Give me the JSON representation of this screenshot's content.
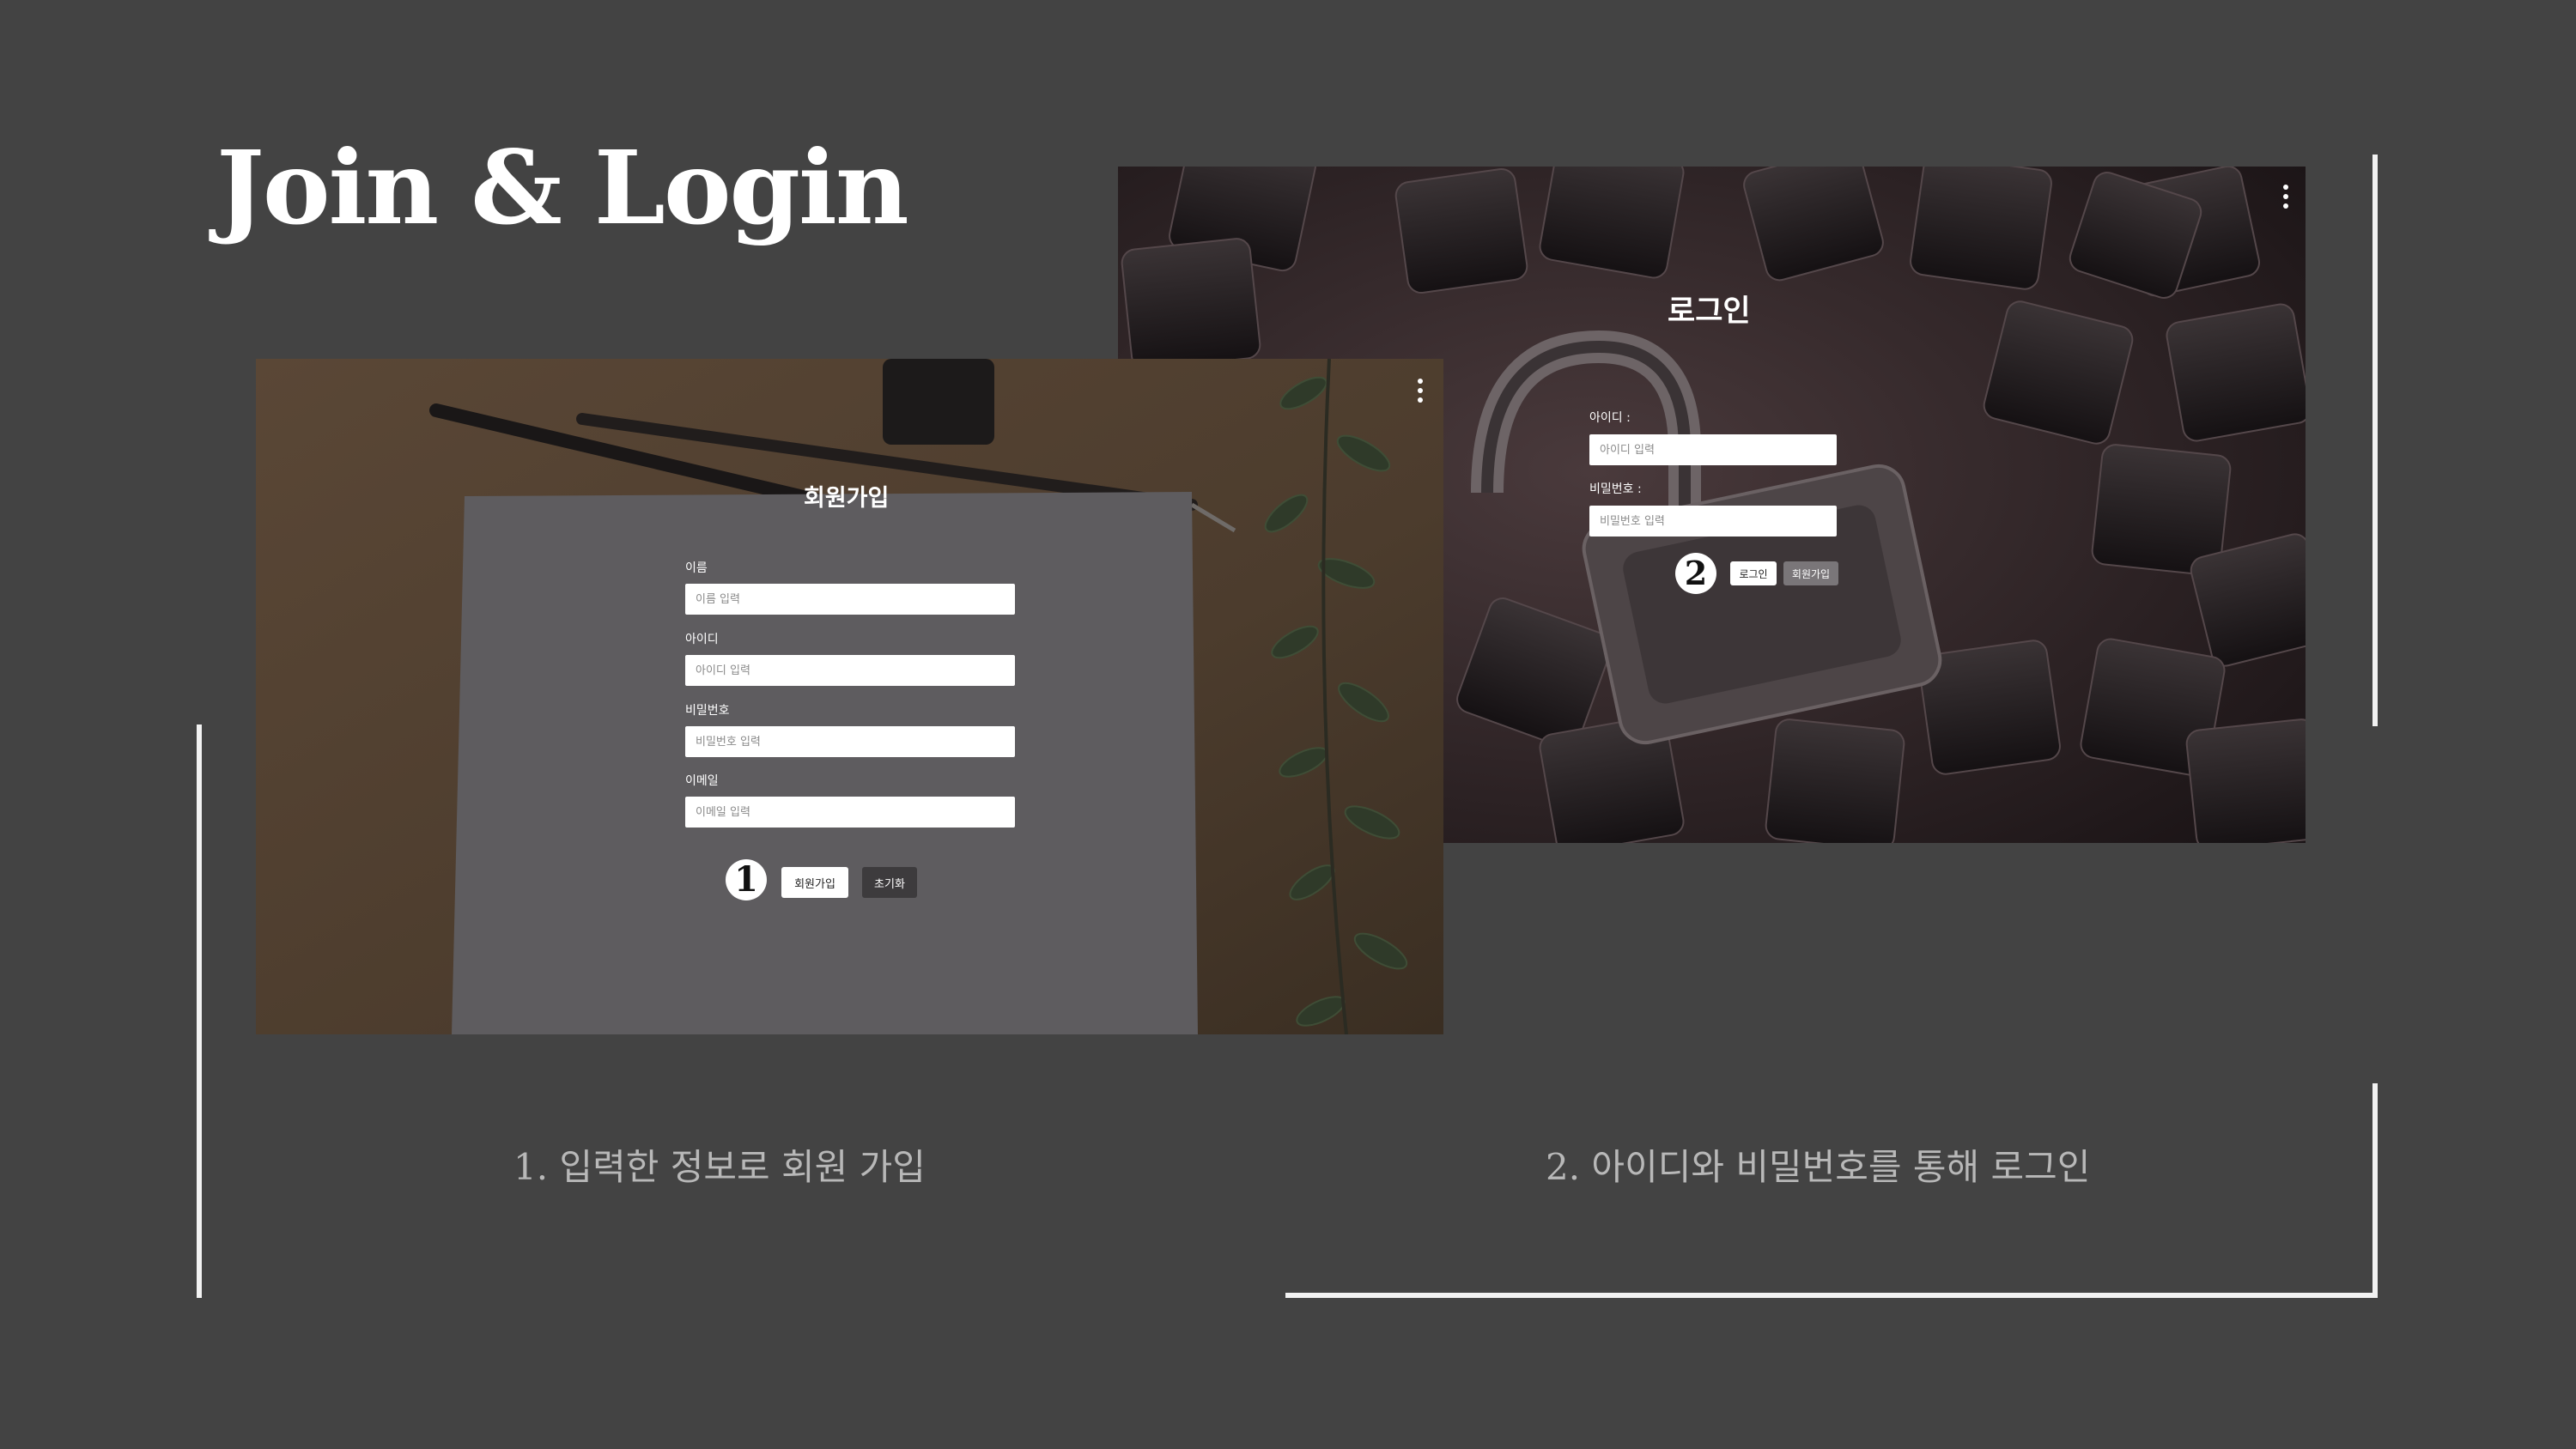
{
  "slide": {
    "title": "Join & Login",
    "captions": {
      "signup": "1. 입력한 정보로 회원 가입",
      "login": "2. 아이디와 비밀번호를 통해 로그인"
    },
    "colors": {
      "background": "#434343",
      "frame_lines": "#f2f2f2",
      "caption": "#b8b8b8"
    }
  },
  "login_screen": {
    "title": "로그인",
    "menu_icon": "kebab-menu-icon",
    "id_label": "아이디 :",
    "id_placeholder": "아이디 입력",
    "pw_label": "비밀번호 :",
    "pw_placeholder": "비밀번호 입력",
    "step_number": "2",
    "login_button": "로그인",
    "signup_button": "회원가입"
  },
  "signup_screen": {
    "title": "회원가입",
    "menu_icon": "kebab-menu-icon",
    "name_label": "이름",
    "name_placeholder": "이름 입력",
    "id_label": "아이디",
    "id_placeholder": "아이디 입력",
    "pw_label": "비밀번호",
    "pw_placeholder": "비밀번호 입력",
    "email_label": "이메일",
    "email_placeholder": "이메일 입력",
    "step_number": "1",
    "signup_button": "회원가입",
    "reset_button": "초기화"
  }
}
